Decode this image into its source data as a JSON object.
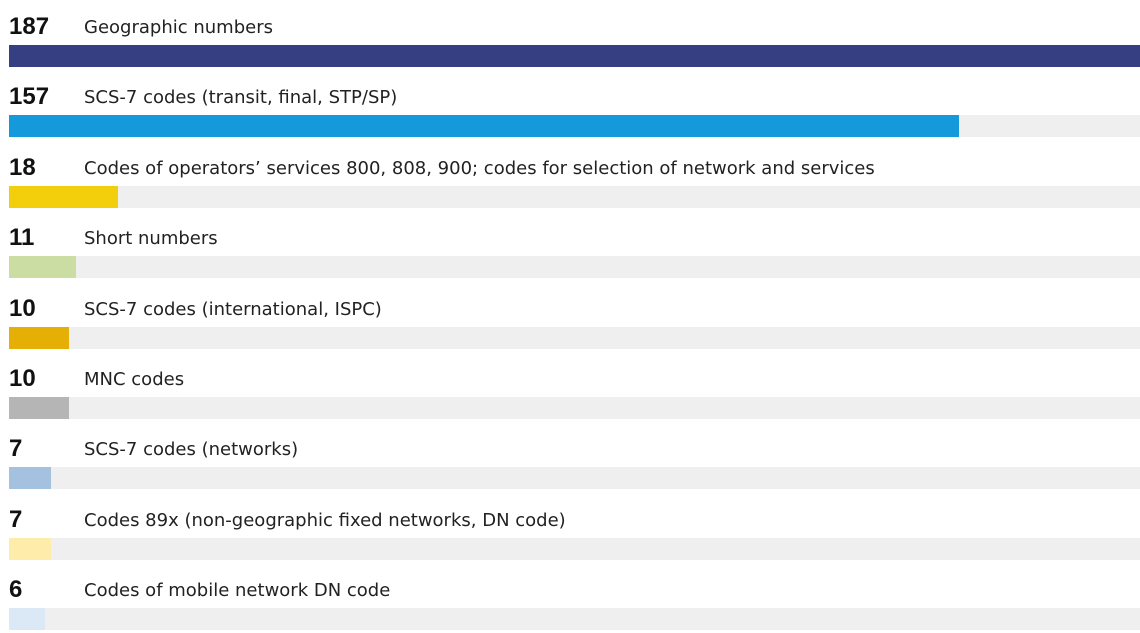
{
  "chart_data": {
    "type": "bar",
    "orientation": "horizontal",
    "max_value": 187,
    "grid": false,
    "legend": "none",
    "bars": [
      {
        "value": 187,
        "label": "Geographic numbers",
        "color": "#363f82"
      },
      {
        "value": 157,
        "label": "SCS-7 codes (transit, final, STP/SP)",
        "color": "#149adb"
      },
      {
        "value": 18,
        "label": "Codes of operators’ services 800, 808, 900; codes for selection of network and services",
        "color": "#f2cf0a"
      },
      {
        "value": 11,
        "label": "Short numbers",
        "color": "#cbdda3"
      },
      {
        "value": 10,
        "label": "SCS-7 codes (international, ISPC)",
        "color": "#e6af05"
      },
      {
        "value": 10,
        "label": "MNC codes",
        "color": "#b5b5b5"
      },
      {
        "value": 7,
        "label": "SCS-7 codes (networks)",
        "color": "#a4c2e0"
      },
      {
        "value": 7,
        "label": "Codes 89x (non-geographic fixed networks, DN code)",
        "color": "#fdecaa"
      },
      {
        "value": 6,
        "label": "Codes of mobile network DN code",
        "color": "#dbe8f6"
      }
    ],
    "track_color": "#efefef"
  }
}
